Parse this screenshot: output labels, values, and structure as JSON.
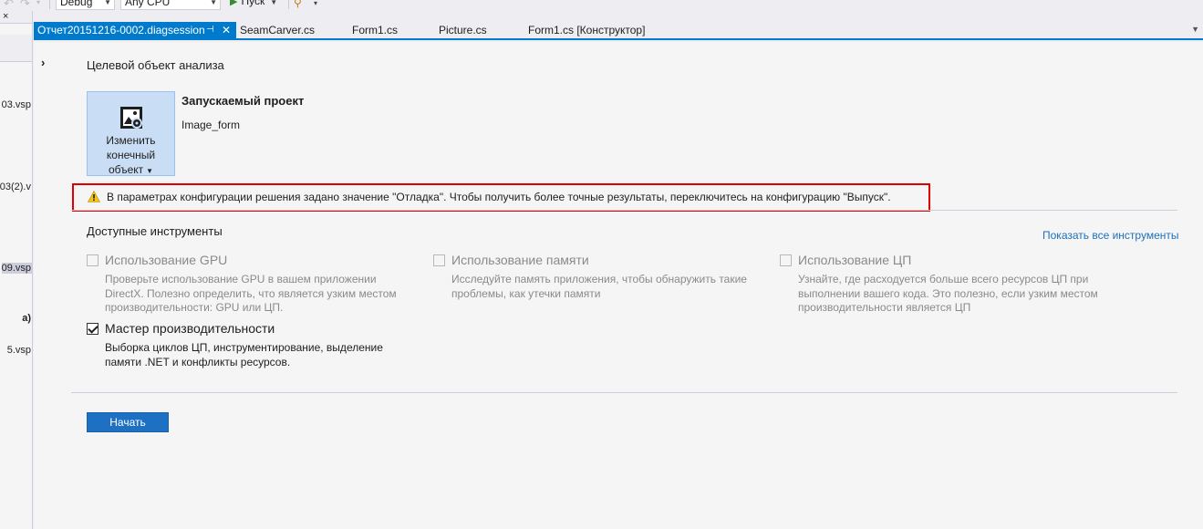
{
  "toolbar": {
    "config_value": "Debug",
    "platform_value": "Any CPU",
    "run_label": "Пуск"
  },
  "left_panel": {
    "items": [
      {
        "label": "03.vsp"
      },
      {
        "label": "03(2).v"
      },
      {
        "label": "09.vsp"
      },
      {
        "label": "a)"
      },
      {
        "label": "5.vsp"
      }
    ]
  },
  "tabs": [
    {
      "label": "Отчет20151216-0002.diagsession",
      "active": true
    },
    {
      "label": "SeamCarver.cs"
    },
    {
      "label": "Form1.cs"
    },
    {
      "label": "Picture.cs"
    },
    {
      "label": "Form1.cs [Конструктор]"
    }
  ],
  "target": {
    "section_title": "Целевой объект анализа",
    "change_button_line1": "Изменить",
    "change_button_line2": "конечный",
    "change_button_line3": "объект",
    "project_label": "Запускаемый проект",
    "project_name": "Image_form"
  },
  "warning": {
    "text": "В параметрах конфигурации решения задано значение \"Отладка\". Чтобы получить более точные результаты, переключитесь на конфигурацию \"Выпуск\"."
  },
  "tools": {
    "section_title": "Доступные инструменты",
    "show_all_link": "Показать все инструменты",
    "gpu": {
      "name": "Использование GPU",
      "desc1": "Проверьте использование GPU в вашем приложении",
      "desc2": "DirectX. Полезно определить, что является узким местом",
      "desc3": "производительности: GPU или ЦП.",
      "checked": false,
      "enabled": false
    },
    "memory": {
      "name": "Использование памяти",
      "desc1": "Исследуйте память приложения, чтобы обнаружить такие",
      "desc2": "проблемы, как утечки памяти",
      "checked": false,
      "enabled": false
    },
    "cpu": {
      "name": "Использование ЦП",
      "desc1": "Узнайте, где расходуется больше всего ресурсов ЦП при",
      "desc2": "выполнении вашего кода. Это полезно, если узким местом",
      "desc3": "производительности является ЦП",
      "checked": false,
      "enabled": false
    },
    "wizard": {
      "name": "Мастер производительности",
      "desc1": "Выборка циклов ЦП, инструментирование, выделение",
      "desc2": "памяти .NET и конфликты ресурсов.",
      "checked": true,
      "enabled": true
    }
  },
  "start_button": "Начать",
  "colors": {
    "accent": "#007acc",
    "button_blue": "#1e70c2",
    "warning_border": "#e00000",
    "link": "#1e70b7"
  }
}
